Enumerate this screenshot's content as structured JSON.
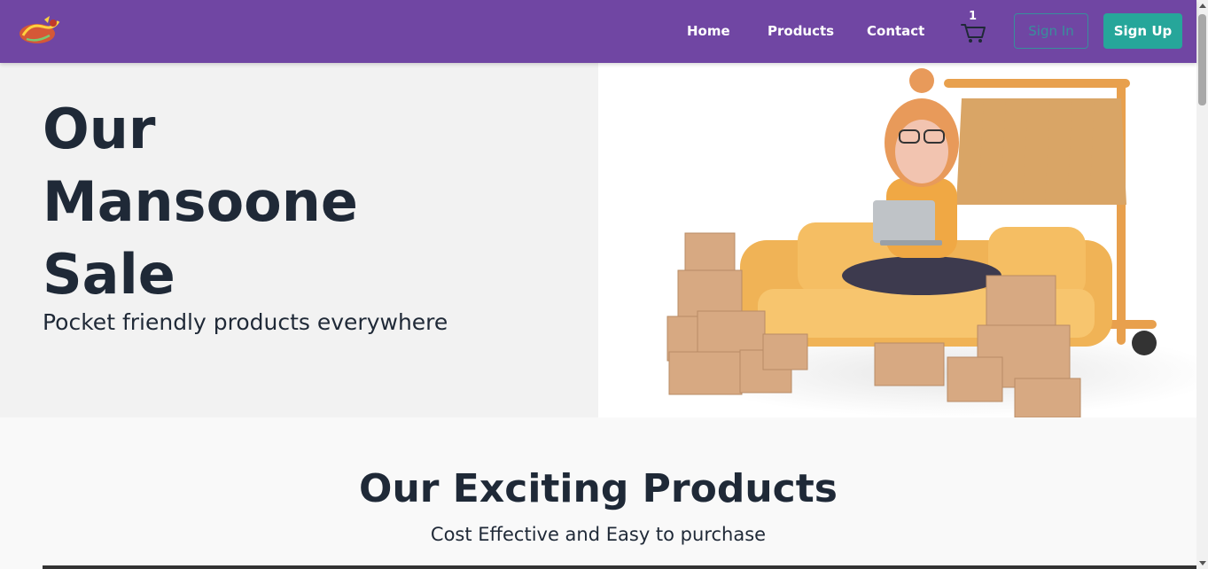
{
  "navbar": {
    "logo_alt": "store-logo",
    "links": [
      {
        "label": "Home"
      },
      {
        "label": "Products"
      },
      {
        "label": "Contact"
      }
    ],
    "cart_count": "1",
    "signin_label": "Sign In",
    "signup_label": "Sign Up"
  },
  "hero": {
    "title_lines": [
      "Our",
      "Mansoone",
      "Sale"
    ],
    "subtitle": "Pocket friendly products everywhere"
  },
  "products_section": {
    "title": "Our Exciting Products",
    "subtitle": "Cost Effective and Easy to purchase"
  },
  "colors": {
    "navbar_bg": "#7046a3",
    "accent": "#26a69a",
    "hero_left_bg": "#f2f2f2",
    "text_dark": "#1f2937"
  },
  "icons": [
    "store-logo",
    "shopping-cart-icon"
  ]
}
